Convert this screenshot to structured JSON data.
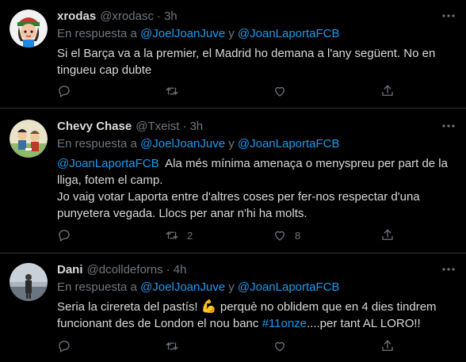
{
  "tweets": [
    {
      "name": "xrodas",
      "handle": "@xrodasc",
      "time": "3h",
      "reply_prefix": "En respuesta a",
      "reply_user1": "@JoelJoanJuve",
      "reply_and": "y",
      "reply_user2": "@JoanLaportaFCB",
      "text": "Si el Barça va a la premier, el Madrid ho demana a l'any següent. No en tingueu cap dubte",
      "retweets": "",
      "likes": ""
    },
    {
      "name": "Chevy Chase",
      "handle": "@Txeist",
      "time": "3h",
      "reply_prefix": "En respuesta a",
      "reply_user1": "@JoelJoanJuve",
      "reply_and": "y",
      "reply_user2": "@JoanLaportaFCB",
      "mention": "@JoanLaportaFCB",
      "text_after_mention": "  Ala més mínima amenaça o menyspreu per part de la lliga, fotem el camp.",
      "text2": "Jo vaig votar Laporta entre d'altres coses per fer-nos respectar d'una punyetera vegada. Llocs per anar n'hi ha molts.",
      "retweets": "2",
      "likes": "8"
    },
    {
      "name": "Dani",
      "handle": "@dcolldeforns",
      "time": "4h",
      "reply_prefix": "En respuesta a",
      "reply_user1": "@JoelJoanJuve",
      "reply_and": "y",
      "reply_user2": "@JoanLaportaFCB",
      "text_a": "Seria la cirereta del pastís!",
      "emoji": "💪",
      "text_b": "perquè no oblidem que en 4 dies tindrem funcionant des de London el nou banc",
      "hashtag": "#11onze",
      "text_c": "....per tant AL LORO!!",
      "retweets": "",
      "likes": ""
    }
  ],
  "separator": "·",
  "icons": {
    "reply": "reply-icon",
    "retweet": "retweet-icon",
    "like": "heart-icon",
    "share": "share-icon",
    "more": "more-icon"
  },
  "colors": {
    "background": "#000000",
    "text": "#d9d9d9",
    "muted": "#6e767d",
    "link": "#1d9bf0",
    "divider": "#2f3336"
  }
}
